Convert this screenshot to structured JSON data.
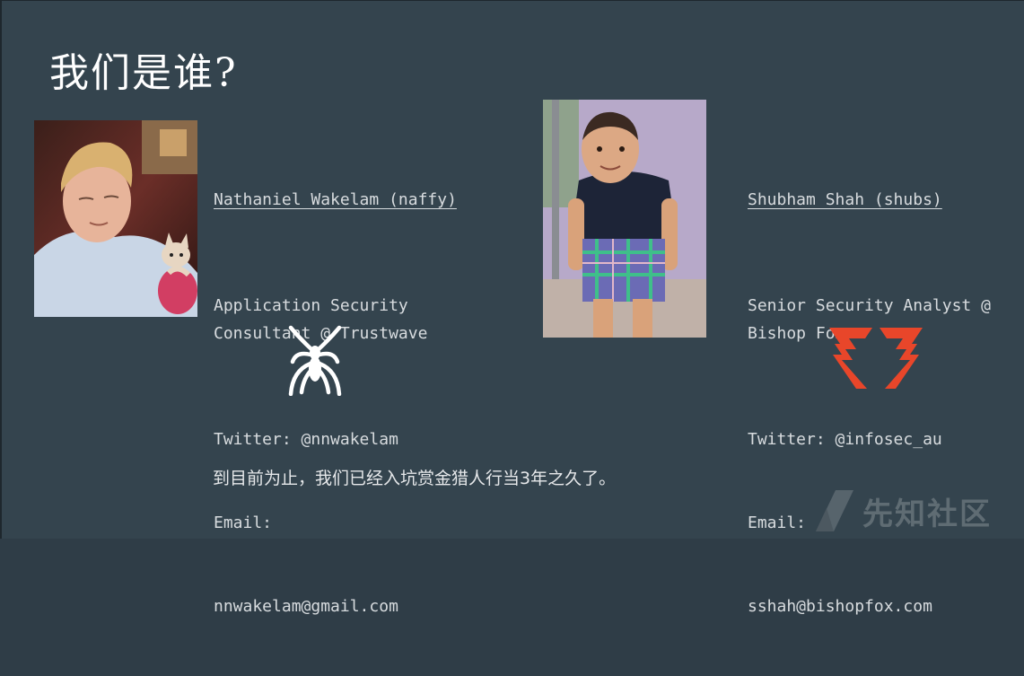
{
  "slide": {
    "title": "我们是谁?",
    "caption": "到目前为止，我们已经入坑赏金猎人行当3年之久了。"
  },
  "people": [
    {
      "name": "Nathaniel Wakelam (naffy)",
      "role": "Application Security\nConsultant @ Trustwave",
      "twitter": "Twitter: @nnwakelam",
      "email_label": "Email:",
      "email": "nnwakelam@gmail.com",
      "logo": "spider-icon"
    },
    {
      "name": "Shubham Shah (shubs)",
      "role": "Senior Security Analyst @\nBishop Fox",
      "twitter": "Twitter: @infosec_au",
      "email_label": "Email:",
      "email": "sshah@bishopfox.com",
      "logo": "bishop-fox-logo"
    }
  ],
  "watermark": {
    "text": "先知社区"
  },
  "colors": {
    "background": "#34444e",
    "text": "#d8dcdf",
    "title": "#ffffff",
    "bishop_fox_accent": "#e8462a"
  }
}
